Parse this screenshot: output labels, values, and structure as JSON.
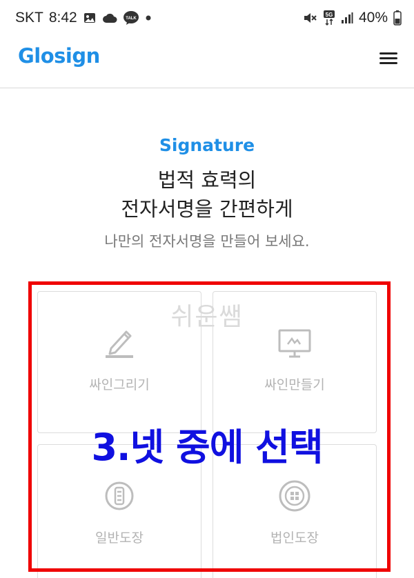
{
  "status_bar": {
    "carrier": "SKT",
    "time": "8:42",
    "network": "5G",
    "battery": "40%",
    "icons": [
      "image-icon",
      "cloud-icon",
      "talk-icon",
      "dot-icon",
      "mute-icon",
      "signal-icon",
      "battery-icon"
    ],
    "talk_badge": "TALK"
  },
  "header": {
    "logo": "Glosign",
    "menu_icon": "hamburger-menu-icon"
  },
  "hero": {
    "kicker": "Signature",
    "title_line1": "법적 효력의",
    "title_line2": "전자서명을 간편하게",
    "subtitle": "나만의 전자서명을 만들어 보세요."
  },
  "options": [
    {
      "label": "싸인그리기",
      "icon": "pen-draw-icon"
    },
    {
      "label": "싸인만들기",
      "icon": "monitor-icon"
    },
    {
      "label": "일반도장",
      "icon": "stamp-icon"
    },
    {
      "label": "법인도장",
      "icon": "corporate-seal-icon"
    }
  ],
  "overlay": {
    "watermark": "쉬운쌤",
    "annotation": "3.넷 중에 선택"
  },
  "colors": {
    "brand": "#1f8fe6",
    "annotation_frame": "#ef0000",
    "annotation_text": "#1010e0",
    "card_label": "#b3b3b3"
  }
}
